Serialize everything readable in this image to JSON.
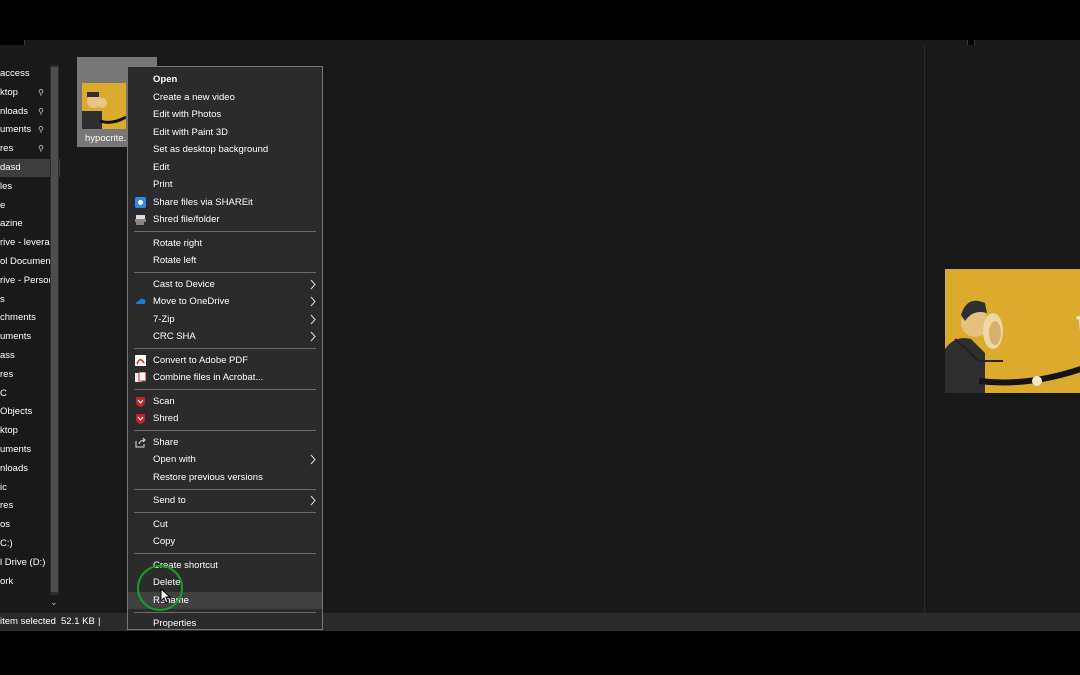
{
  "nav": {
    "items": [
      {
        "label": "access",
        "pinned": false
      },
      {
        "label": "ktop",
        "pinned": true
      },
      {
        "label": "nloads",
        "pinned": true
      },
      {
        "label": "uments",
        "pinned": true
      },
      {
        "label": "res",
        "pinned": true
      },
      {
        "label": "dasd",
        "pinned": false,
        "selected": true
      },
      {
        "label": "les",
        "pinned": false
      },
      {
        "label": "e",
        "pinned": false
      },
      {
        "label": "azine",
        "pinned": false
      },
      {
        "label": "rive - leverag",
        "pinned": false
      },
      {
        "label": "ol Documen",
        "pinned": false
      },
      {
        "label": "rive - Person",
        "pinned": false
      },
      {
        "label": "s",
        "pinned": false
      },
      {
        "label": "chments",
        "pinned": false
      },
      {
        "label": "uments",
        "pinned": false
      },
      {
        "label": "ass",
        "pinned": false
      },
      {
        "label": "res",
        "pinned": false
      },
      {
        "label": "C",
        "pinned": false
      },
      {
        "label": "Objects",
        "pinned": false
      },
      {
        "label": "ktop",
        "pinned": false
      },
      {
        "label": "uments",
        "pinned": false
      },
      {
        "label": "nloads",
        "pinned": false
      },
      {
        "label": "ic",
        "pinned": false
      },
      {
        "label": "res",
        "pinned": false
      },
      {
        "label": "os",
        "pinned": false
      },
      {
        "label": "C:)",
        "pinned": false
      },
      {
        "label": "l Drive (D:)",
        "pinned": false
      },
      {
        "label": "ork",
        "pinned": false
      }
    ]
  },
  "file": {
    "name": "hypocrite."
  },
  "status": {
    "count": "item selected",
    "size": "52.1 KB",
    "divider": "|"
  },
  "context_menu": {
    "items": [
      {
        "type": "item",
        "label": "Open",
        "bold": true
      },
      {
        "type": "item",
        "label": "Create a new video"
      },
      {
        "type": "item",
        "label": "Edit with Photos"
      },
      {
        "type": "item",
        "label": "Edit with Paint 3D"
      },
      {
        "type": "item",
        "label": "Set as desktop background"
      },
      {
        "type": "item",
        "label": "Edit"
      },
      {
        "type": "item",
        "label": "Print"
      },
      {
        "type": "item",
        "label": "Share files via SHAREit",
        "icon": "shareit-icon"
      },
      {
        "type": "item",
        "label": "Shred file/folder",
        "icon": "shredder-icon"
      },
      {
        "type": "sep"
      },
      {
        "type": "item",
        "label": "Rotate right"
      },
      {
        "type": "item",
        "label": "Rotate left"
      },
      {
        "type": "sep"
      },
      {
        "type": "item",
        "label": "Cast to Device",
        "submenu": true
      },
      {
        "type": "item",
        "label": "Move to OneDrive",
        "icon": "onedrive-icon",
        "submenu": true
      },
      {
        "type": "item",
        "label": "7-Zip",
        "submenu": true
      },
      {
        "type": "item",
        "label": "CRC SHA",
        "submenu": true
      },
      {
        "type": "sep"
      },
      {
        "type": "item",
        "label": "Convert to Adobe PDF",
        "icon": "adobe-pdf-icon"
      },
      {
        "type": "item",
        "label": "Combine files in Acrobat...",
        "icon": "acrobat-combine-icon"
      },
      {
        "type": "sep"
      },
      {
        "type": "item",
        "label": "Scan",
        "icon": "mcafee-icon"
      },
      {
        "type": "item",
        "label": "Shred",
        "icon": "mcafee-icon"
      },
      {
        "type": "sep"
      },
      {
        "type": "item",
        "label": "Share",
        "icon": "share-icon"
      },
      {
        "type": "item",
        "label": "Open with",
        "submenu": true
      },
      {
        "type": "item",
        "label": "Restore previous versions"
      },
      {
        "type": "sep"
      },
      {
        "type": "item",
        "label": "Send to",
        "submenu": true
      },
      {
        "type": "sep"
      },
      {
        "type": "item",
        "label": "Cut"
      },
      {
        "type": "item",
        "label": "Copy"
      },
      {
        "type": "sep"
      },
      {
        "type": "item",
        "label": "Create shortcut"
      },
      {
        "type": "item",
        "label": "Delete"
      },
      {
        "type": "item",
        "label": "Rename",
        "highlighted": true
      },
      {
        "type": "sep"
      },
      {
        "type": "item",
        "label": "Properties"
      }
    ]
  },
  "colors": {
    "menu_bg": "#2b2b2b",
    "highlight_circle": "#1e9a2b",
    "image_yellow": "#dcaa2c"
  }
}
